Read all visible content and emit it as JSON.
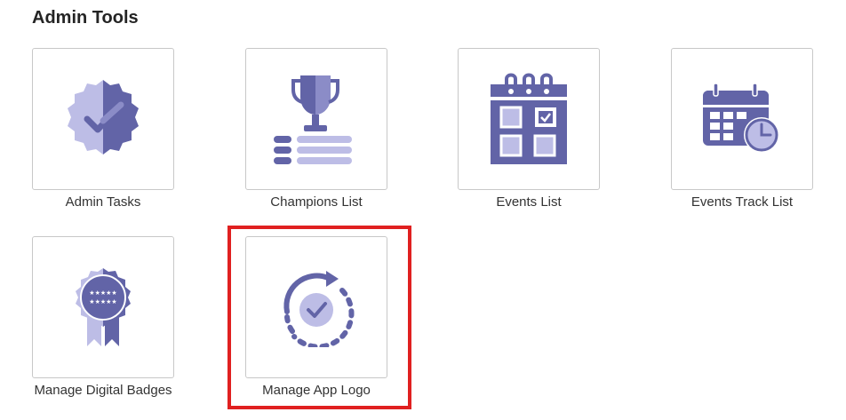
{
  "page": {
    "title": "Admin Tools"
  },
  "tiles": [
    {
      "label": "Admin Tasks",
      "icon": "verified-badge-icon"
    },
    {
      "label": "Champions List",
      "icon": "trophy-list-icon"
    },
    {
      "label": "Events List",
      "icon": "calendar-icon"
    },
    {
      "label": "Events Track List",
      "icon": "calendar-clock-icon"
    },
    {
      "label": "Manage Digital Badges",
      "icon": "award-ribbon-icon"
    },
    {
      "label": "Manage App Logo",
      "icon": "refresh-check-icon"
    }
  ],
  "colors": {
    "icon_dark": "#6264a7",
    "icon_light": "#bdbde6",
    "highlight": "#e02020"
  }
}
